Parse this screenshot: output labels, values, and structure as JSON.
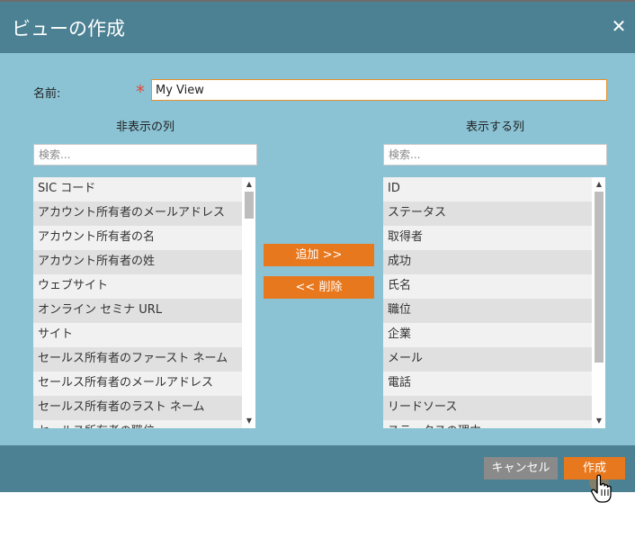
{
  "dialog": {
    "title": "ビューの作成",
    "close_icon": "close-icon"
  },
  "name": {
    "label": "名前:",
    "required_mark": "*",
    "value": "My View"
  },
  "hidden_columns": {
    "heading": "非表示の列",
    "search_placeholder": "検索...",
    "items": [
      "SIC コード",
      "アカウント所有者のメールアドレス",
      "アカウント所有者の名",
      "アカウント所有者の姓",
      "ウェブサイト",
      "オンライン セミナ URL",
      "サイト",
      "セールス所有者のファースト ネーム",
      "セールス所有者のメールアドレス",
      "セールス所有者のラスト ネーム",
      "セールス所有者の職位"
    ]
  },
  "visible_columns": {
    "heading": "表示する列",
    "search_placeholder": "検索...",
    "items": [
      "ID",
      "ステータス",
      "取得者",
      "成功",
      "氏名",
      "職位",
      "企業",
      "メール",
      "電話",
      "リードソース",
      "ステータスの理由"
    ]
  },
  "actions": {
    "add_label": "追加 >>",
    "remove_label": "<< 削除"
  },
  "footer": {
    "cancel_label": "キャンセル",
    "create_label": "作成"
  }
}
